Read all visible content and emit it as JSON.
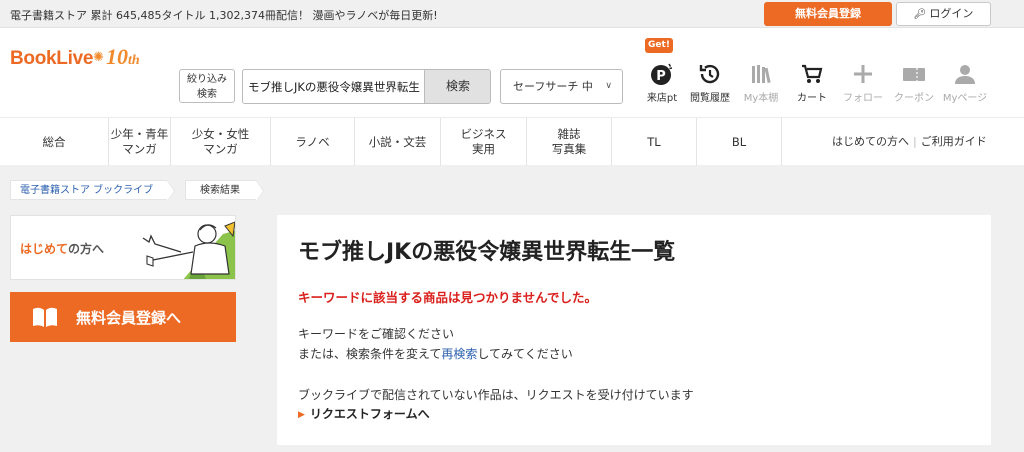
{
  "topbar": {
    "notice": "電子書籍ストア 累計 645,485タイトル 1,302,374冊配信！ 漫画やラノベが毎日更新!",
    "signup": "無料会員登録",
    "login": "ログイン"
  },
  "header": {
    "logo_text": "BookLive",
    "anniversary": "10",
    "anniversary_suffix": "th",
    "filter_label_1": "絞り込み",
    "filter_label_2": "検索",
    "search_value": "モブ推しJKの悪役令嬢異世界転生",
    "search_button": "検索",
    "safe_search": "セーフサーチ 中",
    "get_badge": "Get!",
    "icons": [
      {
        "label": "来店pt",
        "icon": "point-icon"
      },
      {
        "label": "閲覧履歴",
        "icon": "history-icon"
      },
      {
        "label": "My本棚",
        "icon": "bookshelf-icon"
      },
      {
        "label": "カート",
        "icon": "cart-icon"
      },
      {
        "label": "フォロー",
        "icon": "plus-icon"
      },
      {
        "label": "クーポン",
        "icon": "coupon-icon"
      },
      {
        "label": "Myページ",
        "icon": "user-icon"
      }
    ]
  },
  "nav": {
    "items": [
      {
        "line1": "総合",
        "line2": ""
      },
      {
        "line1": "少年・青年",
        "line2": "マンガ"
      },
      {
        "line1": "少女・女性",
        "line2": "マンガ"
      },
      {
        "line1": "ラノベ",
        "line2": ""
      },
      {
        "line1": "小説・文芸",
        "line2": ""
      },
      {
        "line1": "ビジネス",
        "line2": "実用"
      },
      {
        "line1": "雑誌",
        "line2": "写真集"
      },
      {
        "line1": "TL",
        "line2": ""
      },
      {
        "line1": "BL",
        "line2": ""
      }
    ],
    "beginner_link": "はじめての方へ",
    "guide_link": "ご利用ガイド"
  },
  "breadcrumb": {
    "home": "電子書籍ストア ブックライブ",
    "current": "検索結果"
  },
  "sidebar": {
    "beginner_text_a": "はじめて",
    "beginner_text_b": "の方へ",
    "signup_banner": "無料会員登録へ"
  },
  "main": {
    "title": "モブ推しJKの悪役令嬢異世界転生一覧",
    "not_found": "キーワードに該当する商品は見つかりませんでした。",
    "hint1": "キーワードをご確認ください",
    "hint2_pre": "または、検索条件を変えて",
    "hint2_link": "再検索",
    "hint2_post": "してみてください",
    "request_text": "ブックライブで配信されていない作品は、リクエストを受け付けています",
    "request_link": "リクエストフォームへ"
  },
  "colors": {
    "accent": "#ec6a24",
    "link": "#2b5fae",
    "error": "#d9201c"
  }
}
